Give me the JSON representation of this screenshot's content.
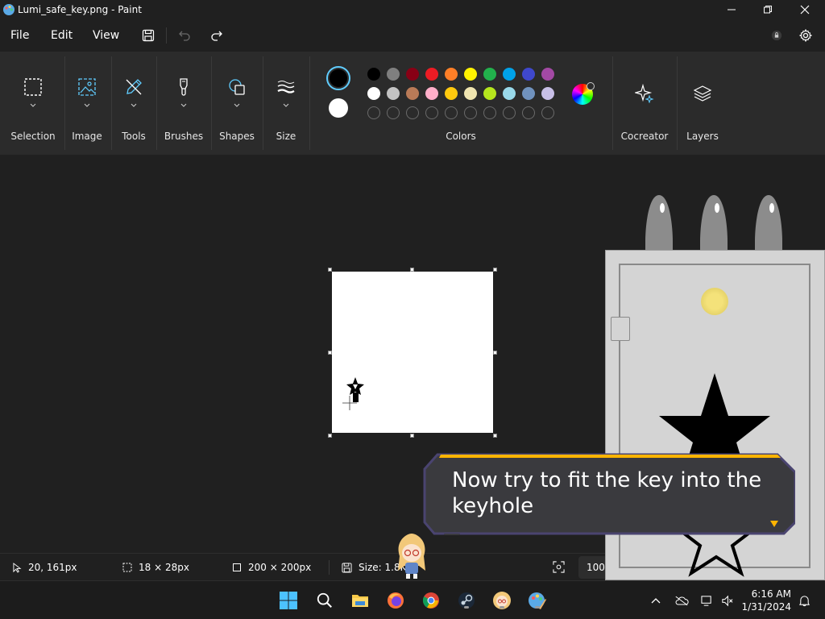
{
  "window": {
    "title": "Lumi_safe_key.png - Paint"
  },
  "menu": {
    "file": "File",
    "edit": "Edit",
    "view": "View"
  },
  "ribbon": {
    "selection": "Selection",
    "image": "Image",
    "tools": "Tools",
    "brushes": "Brushes",
    "shapes": "Shapes",
    "size": "Size",
    "colors": "Colors",
    "cocreator": "Cocreator",
    "layers": "Layers"
  },
  "palette": {
    "primary": "#000000",
    "secondary": "#ffffff",
    "row1": [
      "#000000",
      "#7f7f7f",
      "#880015",
      "#ed1c24",
      "#ff7f27",
      "#fff200",
      "#22b14c",
      "#00a2e8",
      "#3f48cc",
      "#a349a4"
    ],
    "row2": [
      "#ffffff",
      "#c3c3c3",
      "#b97a57",
      "#ffaec9",
      "#ffc90e",
      "#efe4b0",
      "#b5e61d",
      "#99d9ea",
      "#7092be",
      "#c8bfe7"
    ]
  },
  "status": {
    "cursor": "20, 161px",
    "selection": "18 × 28px",
    "canvas": "200 × 200px",
    "size": "Size: 1.8K",
    "zoom": "100"
  },
  "dialog": {
    "text": "Now try to fit the key into the keyhole"
  },
  "clock": {
    "time": "6:16 AM",
    "date": "1/31/2024"
  },
  "colors": {
    "accent": "#60cdff",
    "dialog_border": "#ffb400",
    "dialog_bg": "#3a3a3e"
  }
}
